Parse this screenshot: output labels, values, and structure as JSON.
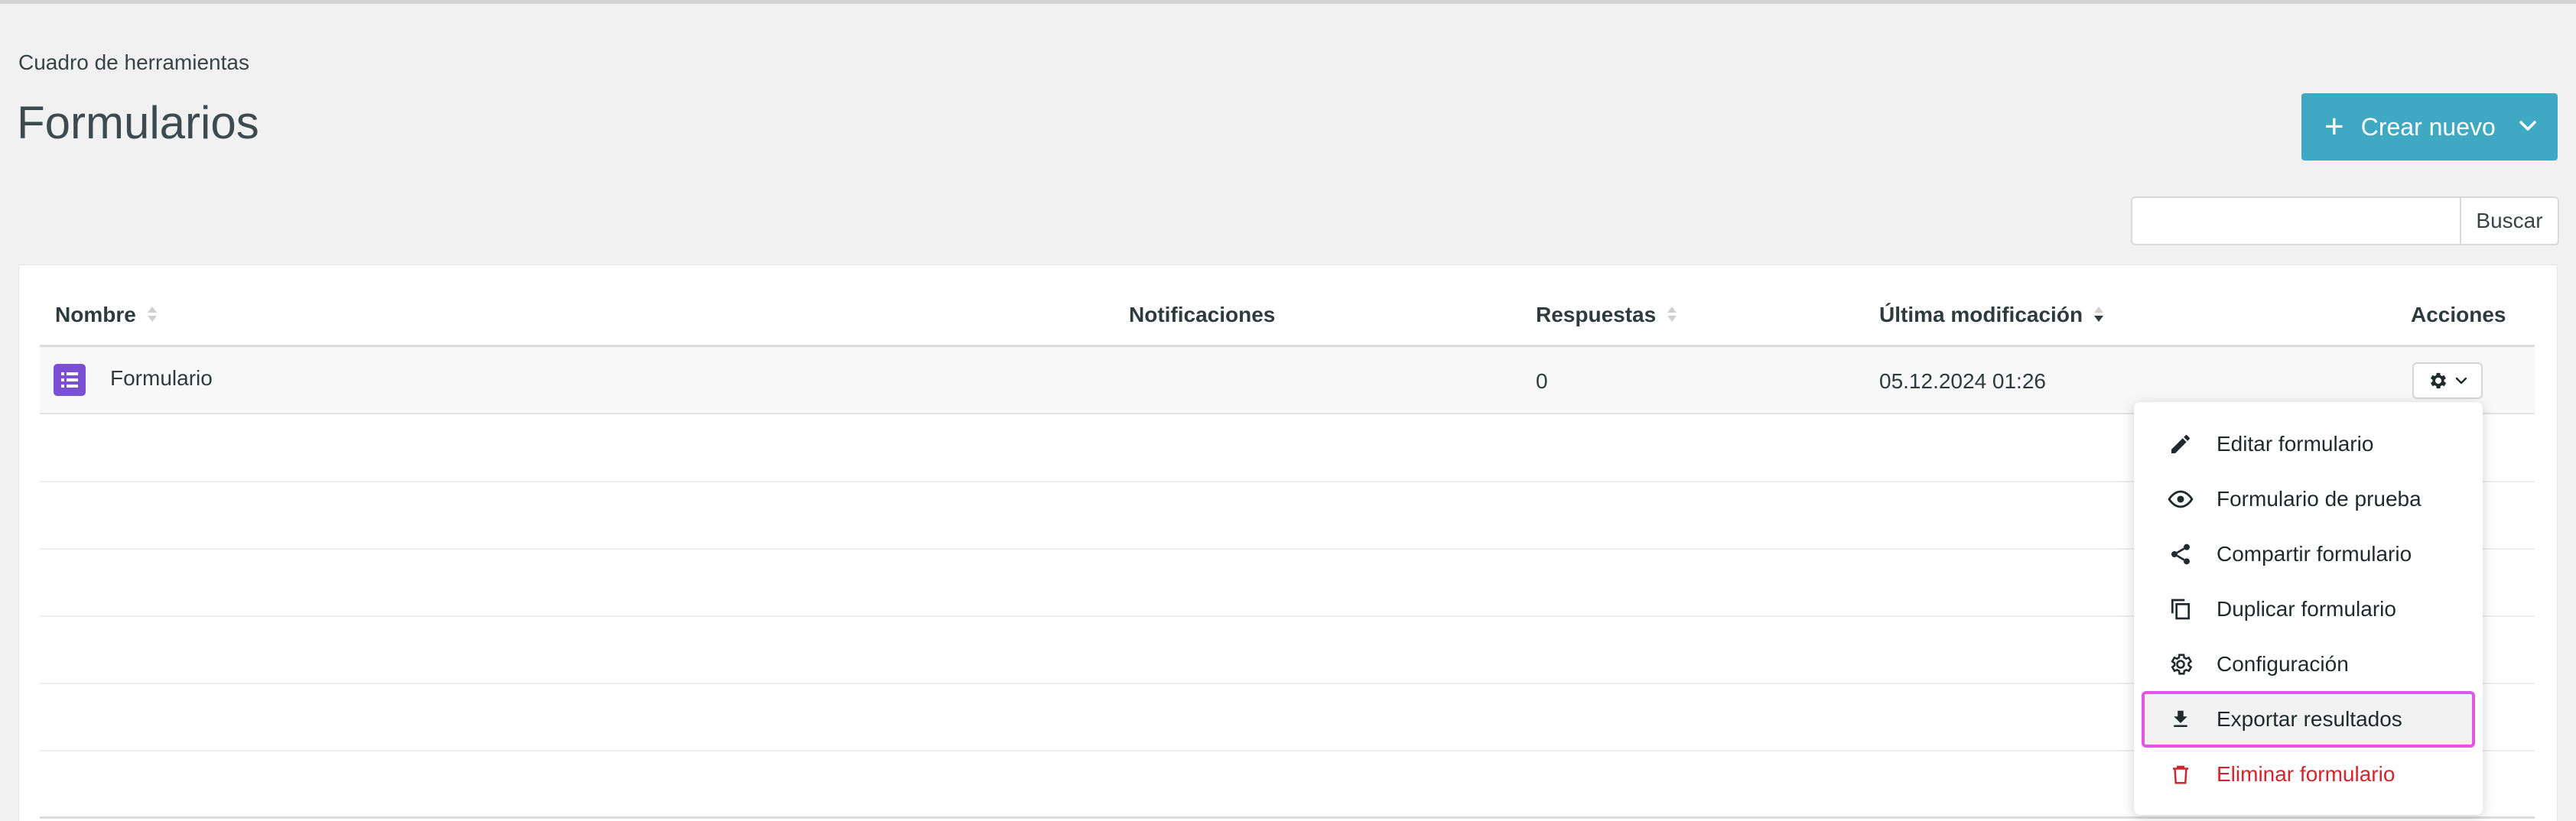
{
  "breadcrumb": "Cuadro de herramientas",
  "page_title": "Formularios",
  "create_button": {
    "label": "Crear nuevo",
    "icon": "plus-icon"
  },
  "search": {
    "placeholder": "",
    "button_label": "Buscar"
  },
  "table": {
    "columns": [
      "Nombre",
      "Notificaciones",
      "Respuestas",
      "Última modificación",
      "Acciones"
    ],
    "rows": [
      {
        "name": "Formulario",
        "notifications": "",
        "responses": "0",
        "modified": "05.12.2024 01:26"
      }
    ]
  },
  "actions_menu": {
    "items": [
      {
        "label": "Editar formulario",
        "icon": "pencil-icon"
      },
      {
        "label": "Formulario de prueba",
        "icon": "eye-icon"
      },
      {
        "label": "Compartir formulario",
        "icon": "share-icon"
      },
      {
        "label": "Duplicar formulario",
        "icon": "copy-icon"
      },
      {
        "label": "Configuración",
        "icon": "gear-icon"
      },
      {
        "label": "Exportar resultados",
        "icon": "download-icon",
        "highlighted": true
      },
      {
        "label": "Eliminar formulario",
        "icon": "trash-icon",
        "danger": true
      }
    ]
  },
  "colors": {
    "accent": "#3fa9c3",
    "danger": "#d0262f",
    "form_icon": "#7a4fd1",
    "highlight_outline": "#e455e6"
  }
}
